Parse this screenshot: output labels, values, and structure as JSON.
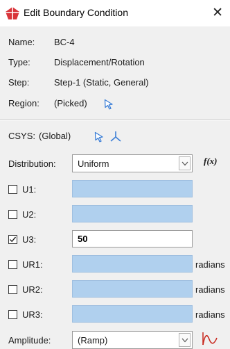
{
  "window": {
    "title": "Edit Boundary Condition",
    "close_glyph": "✕"
  },
  "info": {
    "name_label": "Name:",
    "name_value": "BC-4",
    "type_label": "Type:",
    "type_value": "Displacement/Rotation",
    "step_label": "Step:",
    "step_value": "Step-1 (Static, General)",
    "region_label": "Region:",
    "region_value": "(Picked)"
  },
  "csys": {
    "label": "CSYS:",
    "value": "(Global)"
  },
  "distribution": {
    "label": "Distribution:",
    "value": "Uniform",
    "fx_label": "f(x)"
  },
  "dofs": [
    {
      "label": "U1:",
      "checked": false,
      "value": "",
      "unit": ""
    },
    {
      "label": "U2:",
      "checked": false,
      "value": "",
      "unit": ""
    },
    {
      "label": "U3:",
      "checked": true,
      "value": "50",
      "unit": ""
    },
    {
      "label": "UR1:",
      "checked": false,
      "value": "",
      "unit": "radians"
    },
    {
      "label": "UR2:",
      "checked": false,
      "value": "",
      "unit": "radians"
    },
    {
      "label": "UR3:",
      "checked": false,
      "value": "",
      "unit": "radians"
    }
  ],
  "amplitude": {
    "label": "Amplitude:",
    "value": "(Ramp)"
  },
  "colors": {
    "accent": "#3b7ed6",
    "disabled_field": "#b0d0ee",
    "icon_red": "#c8281e",
    "app_icon": "#d9353a"
  },
  "icons": {
    "app": "abaqus-app-icon",
    "close": "close-icon",
    "select": "select-cursor-icon",
    "csys": "csys-axes-icon",
    "amplitude": "create-amplitude-icon"
  }
}
